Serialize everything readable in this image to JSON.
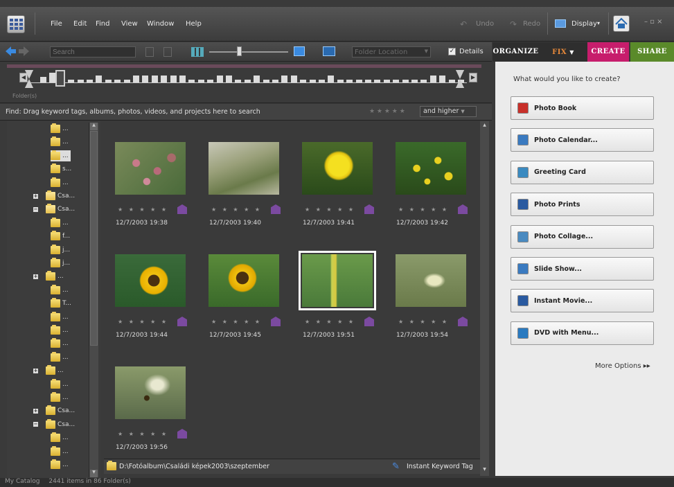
{
  "menu": {
    "file": "File",
    "edit": "Edit",
    "find": "Find",
    "view": "View",
    "window": "Window",
    "help": "Help",
    "undo": "Undo",
    "redo": "Redo",
    "display": "Display",
    "display_arrow": "▾"
  },
  "toolbar": {
    "search_placeholder": "Search",
    "folder_location": "Folder Location",
    "details": "Details"
  },
  "tabs": {
    "organize": "ORGANIZE",
    "fix": "FIX",
    "create": "CREATE",
    "share": "SHARE"
  },
  "timeline": {
    "label": "Folder(s)"
  },
  "findbar": {
    "text": "Find: Drag keyword tags, albums, photos, videos, and projects here to search",
    "rating": "★ ★ ★ ★ ★",
    "and_higher": "and higher"
  },
  "tree": {
    "items": [
      "...",
      "...",
      "...",
      "s...",
      "...",
      "Csa...",
      "Csa...",
      "...",
      "f...",
      "j...",
      "j...",
      "...",
      "...",
      "T...",
      "...",
      "...",
      "...",
      "...",
      "...",
      "...",
      "...",
      "Csa...",
      "Csa...",
      "...",
      "...",
      "..."
    ]
  },
  "photos": [
    {
      "date": "12/7/2003 19:38",
      "rating": "★ ★ ★ ★ ★"
    },
    {
      "date": "12/7/2003 19:40",
      "rating": "★ ★ ★ ★ ★"
    },
    {
      "date": "12/7/2003 19:41",
      "rating": "★ ★ ★ ★ ★"
    },
    {
      "date": "12/7/2003 19:42",
      "rating": "★ ★ ★ ★ ★"
    },
    {
      "date": "12/7/2003 19:44",
      "rating": "★ ★ ★ ★ ★"
    },
    {
      "date": "12/7/2003 19:45",
      "rating": "★ ★ ★ ★ ★"
    },
    {
      "date": "12/7/2003 19:51",
      "rating": "★ ★ ★ ★ ★"
    },
    {
      "date": "12/7/2003 19:54",
      "rating": "★ ★ ★ ★ ★"
    },
    {
      "date": "12/7/2003 19:56",
      "rating": "★ ★ ★ ★ ★"
    }
  ],
  "path": {
    "text": "D:\\Fotóalbum\\Családi képek2003\\szeptember",
    "instant_tag": "Instant Keyword Tag"
  },
  "status": {
    "catalog": "My Catalog",
    "items": "2441 items in 86 Folder(s)"
  },
  "panel": {
    "question": "What would you like to create?",
    "buttons": [
      "Photo Book",
      "Photo Calendar...",
      "Greeting Card",
      "Photo Prints",
      "Photo Collage...",
      "Slide Show...",
      "Instant Movie...",
      "DVD with Menu..."
    ],
    "more": "More Options ▸▸"
  },
  "colors": {
    "organize": "#333333",
    "fix": "#e06a1a",
    "create": "#c71d6c",
    "share": "#5a8a2a"
  },
  "icons": [
    "app-menu-icon",
    "back-arrow-icon",
    "forward-arrow-icon",
    "home-icon",
    "undo-icon",
    "redo-icon",
    "display-icon",
    "tag-icon",
    "folder-icon"
  ]
}
